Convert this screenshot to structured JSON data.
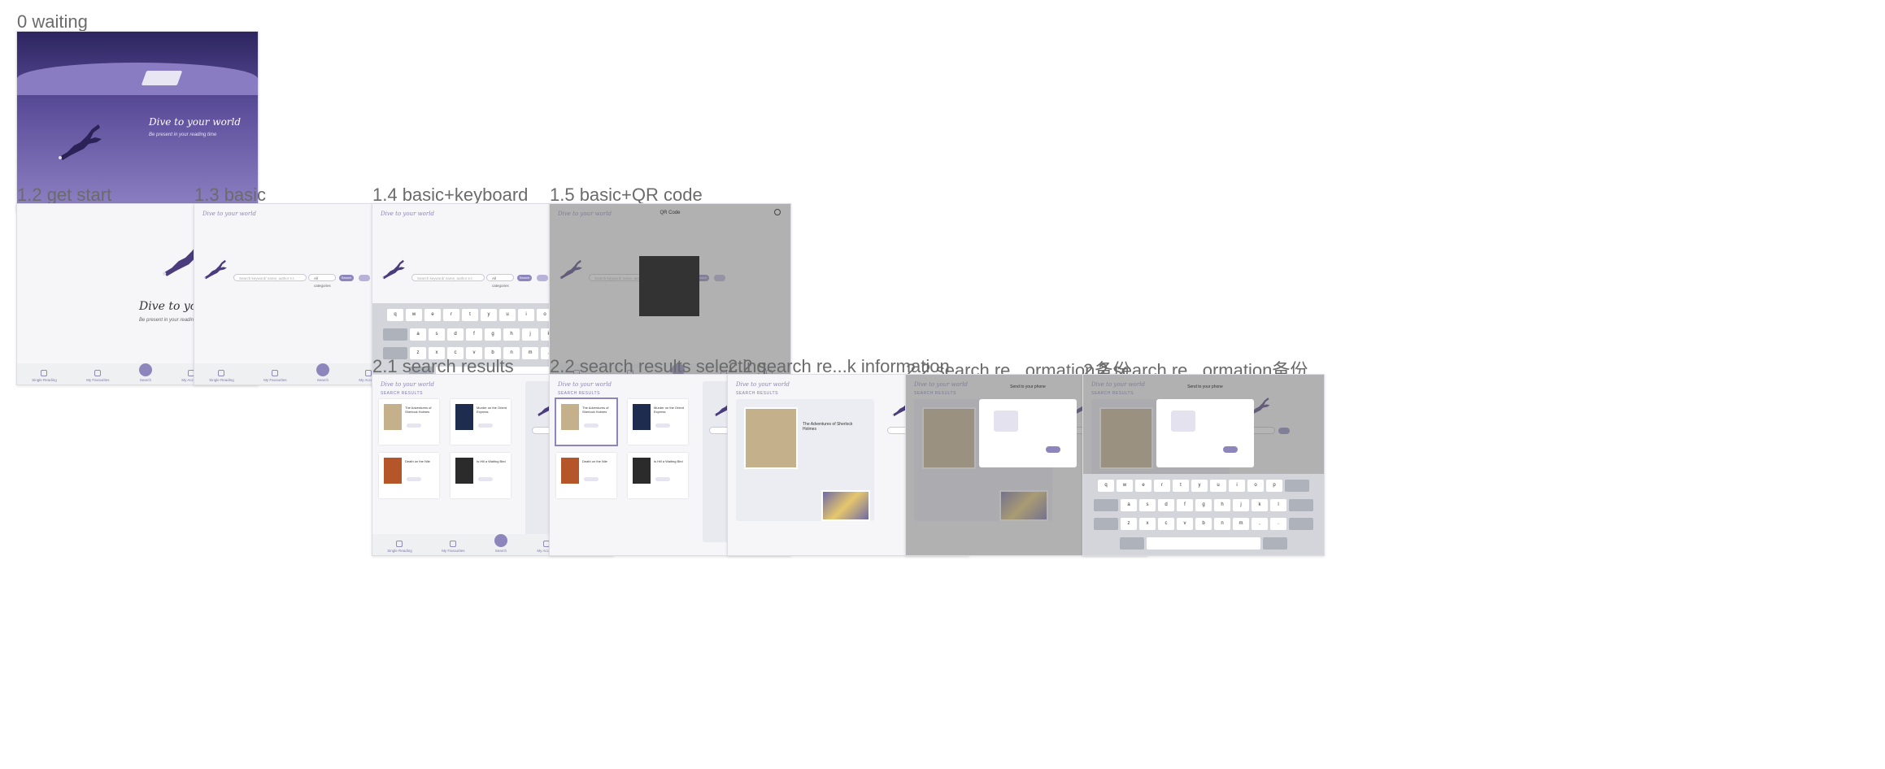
{
  "artboards": [
    {
      "label": "0 waiting",
      "variant": "waiting"
    },
    {
      "label": "1.2 get start",
      "variant": "getstart"
    },
    {
      "label": "1.3 basic",
      "variant": "basic"
    },
    {
      "label": "1.4 basic+keyboard",
      "variant": "keyboard"
    },
    {
      "label": "1.5 basic+QR code",
      "variant": "qr"
    },
    {
      "label": "2.1 search results",
      "variant": "results"
    },
    {
      "label": "2.2 search results selecting",
      "variant": "selecting"
    },
    {
      "label": "2.2 search re...k information",
      "variant": "info"
    },
    {
      "label": "2.2 search re...ormation备份",
      "variant": "modal"
    },
    {
      "label": "2.2 search re...ormation备份",
      "variant": "modal-keyboard"
    }
  ],
  "app": {
    "hero_title": "Dive to your world",
    "hero_subtitle": "Be present in your reading time",
    "header_title": "Dive to your world",
    "search_placeholder": "Search keyword/ name, author e.t.",
    "category": "All categories",
    "search_button": "Search",
    "qr_title": "QR Code",
    "results_title": "SEARCH RESULTS",
    "modal_title": "Send to your phone",
    "tabs": [
      "Single Reading",
      "My Favourites",
      "Search",
      "My Account",
      "My Cart"
    ],
    "keyboard_rows": [
      [
        "q",
        "w",
        "e",
        "r",
        "t",
        "y",
        "u",
        "i",
        "o",
        "p"
      ],
      [
        "a",
        "s",
        "d",
        "f",
        "g",
        "h",
        "j",
        "k",
        "l"
      ],
      [
        "z",
        "x",
        "c",
        "v",
        "b",
        "n",
        "m",
        ",",
        "."
      ]
    ],
    "books": [
      "The Adventures of Sherlock Holmes",
      "Murder on the Orient Express",
      "Death on the Nile",
      "Is Hill a Waiting Bird"
    ]
  },
  "colors": {
    "accent": "#8d86bd",
    "accent_dark": "#4a3c7d",
    "tab_bg": "#eef0f2",
    "page_bg": "#f6f6f9",
    "keyboard_bg": "#d3d5db",
    "overlay": "#777777"
  }
}
